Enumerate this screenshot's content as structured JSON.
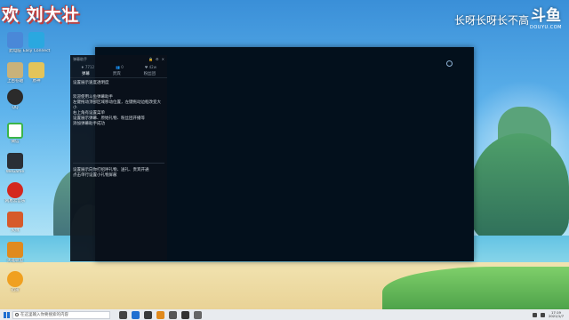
{
  "overlay": {
    "streamer_title": "欢  刘大壮",
    "slogan": "长呀长呀长不高",
    "logo": "斗鱼",
    "logo_sub": "DOUYU.COM"
  },
  "desktop_icons": [
    {
      "name": "此电脑",
      "color": "#4a88d8"
    },
    {
      "name": "Easy Connect",
      "color": "#2aa8e0"
    },
    {
      "name": "上古卷轴",
      "color": "#c9b27a"
    },
    {
      "name": "原神",
      "color": "#e3c45a"
    },
    {
      "name": "QQ",
      "color": "#2b2b2b"
    },
    {
      "name": "微信",
      "color": "#ffffff"
    },
    {
      "name": "WeGame",
      "color": "#2a2f36"
    },
    {
      "name": "网易云音乐",
      "color": "#d3281f"
    },
    {
      "name": "火绒",
      "color": "#d65a2a"
    },
    {
      "name": "英雄联盟",
      "color": "#2e4a7a"
    },
    {
      "name": "迅雷",
      "color": "#f0a020"
    }
  ],
  "chat": {
    "header_title": "弹幕助手",
    "stats": [
      "♦ 7712",
      "👥 0",
      "♥ 42w"
    ],
    "tabs": [
      "弹幕",
      "贵宾",
      "粉丝团"
    ],
    "active_tab": 0,
    "messages": [
      "设置展示速度透明度",
      "",
      "欢迎使用斗鱼弹幕助手",
      "左键拖动顶部区域移动位置，左键拖动边框改变大小",
      "右上角有设置菜单",
      "设置展示弹幕、原始礼物、粉丝团开播等",
      "添加弹幕助手成功",
      "",
      "设置展示向你打招呼礼物、送礼、贵宾开通",
      "点击单行设置小礼物屏蔽"
    ]
  },
  "taskbar": {
    "search_placeholder": "在这里输入你要搜索的内容",
    "time": "17:19",
    "date": "2021/1/7"
  }
}
